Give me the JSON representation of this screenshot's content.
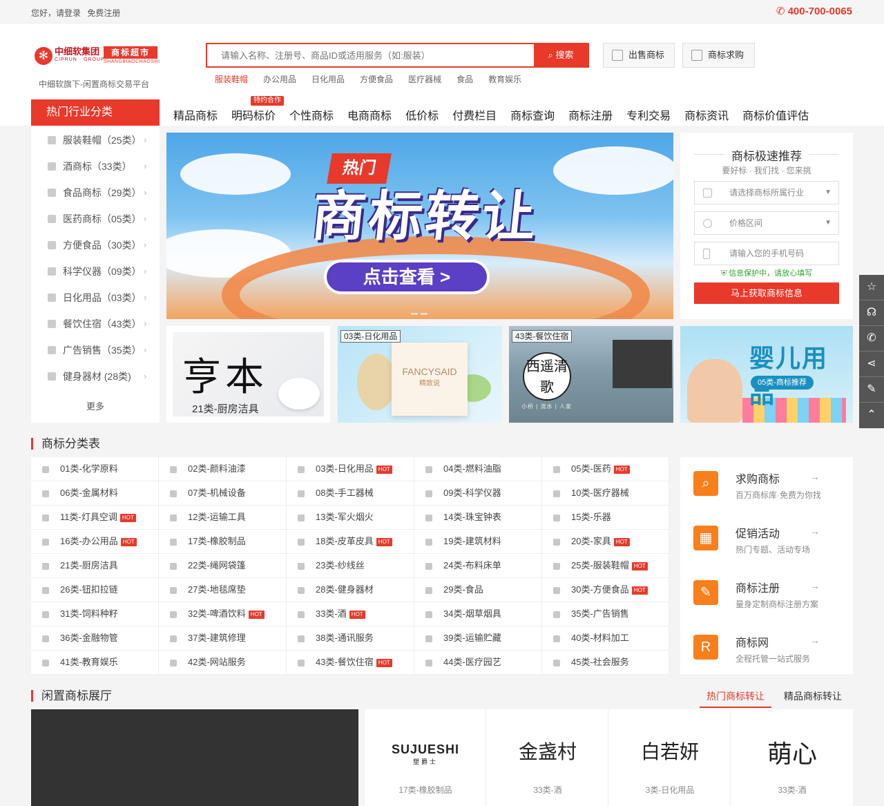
{
  "topbar": {
    "greeting": "您好，请登录",
    "register": "免费注册",
    "phone": "400-700-0065"
  },
  "logo": {
    "name": "中细软集团",
    "en": "CIPRUN · GROUP",
    "brand": "商标超市",
    "brand_en": "SHANGBIAOCHAOSHI",
    "slogan": "中细软旗下-闲置商标交易平台"
  },
  "search": {
    "placeholder": "请输入名称、注册号、商品ID或适用服务（如:服装）",
    "button": "搜索",
    "hot": [
      "服装鞋帽",
      "办公用品",
      "日化用品",
      "方便食品",
      "医疗器械",
      "食品",
      "教育娱乐"
    ]
  },
  "header_buttons": {
    "sell": "出售商标",
    "buy": "商标求购"
  },
  "nav": {
    "category_title": "热门行业分类",
    "tag": "特约合作",
    "items": [
      "精品商标",
      "明码标价",
      "个性商标",
      "电商商标",
      "低价标",
      "付费栏目",
      "商标查询",
      "商标注册",
      "专利交易",
      "商标资讯",
      "商标价值评估"
    ]
  },
  "categories": {
    "items": [
      "服装鞋帽（25类）",
      "酒商标（33类）",
      "食品商标（29类）",
      "医药商标（05类）",
      "方便食品（30类）",
      "科学仪器（09类）",
      "日化用品（03类）",
      "餐饮住宿（43类）",
      "广告销售（35类）",
      "健身器材 (28类)"
    ],
    "more": "更多"
  },
  "banner": {
    "hot": "热门",
    "title": "商标转让",
    "cta": "点击查看 >"
  },
  "recommend": {
    "title": "商标极速推荐",
    "subtitle": "要好标 · 我们找 · 您来挑",
    "industry_placeholder": "请选择商标所属行业",
    "price_placeholder": "价格区间",
    "phone_placeholder": "请输入您的手机号码",
    "tip": "信息保护中，请放心填写",
    "submit": "马上获取商标信息"
  },
  "tiles": [
    {
      "big": "亨本",
      "caption": "21类-厨房洁具"
    },
    {
      "label": "03类-日化用品",
      "product": "FANCYSAID",
      "product_cn": "精致说"
    },
    {
      "label": "43类-餐饮住宿",
      "seal": "西遥清歌",
      "sub": "小桥 | 流水 | 人家"
    },
    {
      "title": "婴儿用品",
      "pill": "05类-商标推荐"
    }
  ],
  "class_table": {
    "title": "商标分类表",
    "hot_label": "HOT",
    "cells": [
      {
        "name": "01类-化学原料",
        "hot": false
      },
      {
        "name": "02类-颜料油漆",
        "hot": false
      },
      {
        "name": "03类-日化用品",
        "hot": true
      },
      {
        "name": "04类-燃料油脂",
        "hot": false
      },
      {
        "name": "05类-医药",
        "hot": true
      },
      {
        "name": "06类-金属材料",
        "hot": false
      },
      {
        "name": "07类-机械设备",
        "hot": false
      },
      {
        "name": "08类-手工器械",
        "hot": false
      },
      {
        "name": "09类-科学仪器",
        "hot": false
      },
      {
        "name": "10类-医疗器械",
        "hot": false
      },
      {
        "name": "11类-灯具空调",
        "hot": true
      },
      {
        "name": "12类-运输工具",
        "hot": false
      },
      {
        "name": "13类-军火烟火",
        "hot": false
      },
      {
        "name": "14类-珠宝钟表",
        "hot": false
      },
      {
        "name": "15类-乐器",
        "hot": false
      },
      {
        "name": "16类-办公用品",
        "hot": true
      },
      {
        "name": "17类-橡胶制品",
        "hot": false
      },
      {
        "name": "18类-皮革皮具",
        "hot": true
      },
      {
        "name": "19类-建筑材料",
        "hot": false
      },
      {
        "name": "20类-家具",
        "hot": true
      },
      {
        "name": "21类-厨房洁具",
        "hot": false
      },
      {
        "name": "22类-绳网袋篷",
        "hot": false
      },
      {
        "name": "23类-纱线丝",
        "hot": false
      },
      {
        "name": "24类-布料床单",
        "hot": false
      },
      {
        "name": "25类-服装鞋帽",
        "hot": true
      },
      {
        "name": "26类-钮扣拉链",
        "hot": false
      },
      {
        "name": "27类-地毯席垫",
        "hot": false
      },
      {
        "name": "28类-健身器材",
        "hot": false
      },
      {
        "name": "29类-食品",
        "hot": false
      },
      {
        "name": "30类-方便食品",
        "hot": true
      },
      {
        "name": "31类-饲料种籽",
        "hot": false
      },
      {
        "name": "32类-啤酒饮料",
        "hot": true
      },
      {
        "name": "33类-酒",
        "hot": true
      },
      {
        "name": "34类-烟草烟具",
        "hot": false
      },
      {
        "name": "35类-广告销售",
        "hot": false
      },
      {
        "name": "36类-金融物管",
        "hot": false
      },
      {
        "name": "37类-建筑修理",
        "hot": false
      },
      {
        "name": "38类-通讯服务",
        "hot": false
      },
      {
        "name": "39类-运输贮藏",
        "hot": false
      },
      {
        "name": "40类-材料加工",
        "hot": false
      },
      {
        "name": "41类-教育娱乐",
        "hot": false
      },
      {
        "name": "42类-网站服务",
        "hot": false
      },
      {
        "name": "43类-餐饮住宿",
        "hot": true
      },
      {
        "name": "44类-医疗园艺",
        "hot": false
      },
      {
        "name": "45类-社会服务",
        "hot": false
      }
    ]
  },
  "services": [
    {
      "title": "求购商标",
      "desc": "百万商标库·免费为你找"
    },
    {
      "title": "促销活动",
      "desc": "热门专题、活动专场"
    },
    {
      "title": "商标注册",
      "desc": "量身定制商标注册方案"
    },
    {
      "title": "商标网",
      "desc": "全程托管一站式服务",
      "icon_letter": "R"
    }
  ],
  "hall": {
    "title": "闲置商标展厅",
    "tabs": [
      "热门商标转让",
      "精品商标转让"
    ],
    "cards": [
      {
        "name": "SUJUESHI",
        "name_cn": "塑爵士",
        "class": "17类-橡胶制品"
      },
      {
        "name": "金盏村",
        "class": "33类-酒"
      },
      {
        "name": "白若妍",
        "class": "3类-日化用品"
      },
      {
        "name": "萌心",
        "class": "33类-酒"
      }
    ]
  },
  "float_icons": [
    "star-icon",
    "headset-icon",
    "phone-icon",
    "share-icon",
    "edit-icon",
    "up-arrow-icon"
  ],
  "colors": {
    "accent": "#e8392b",
    "orange": "#f77f1c"
  }
}
